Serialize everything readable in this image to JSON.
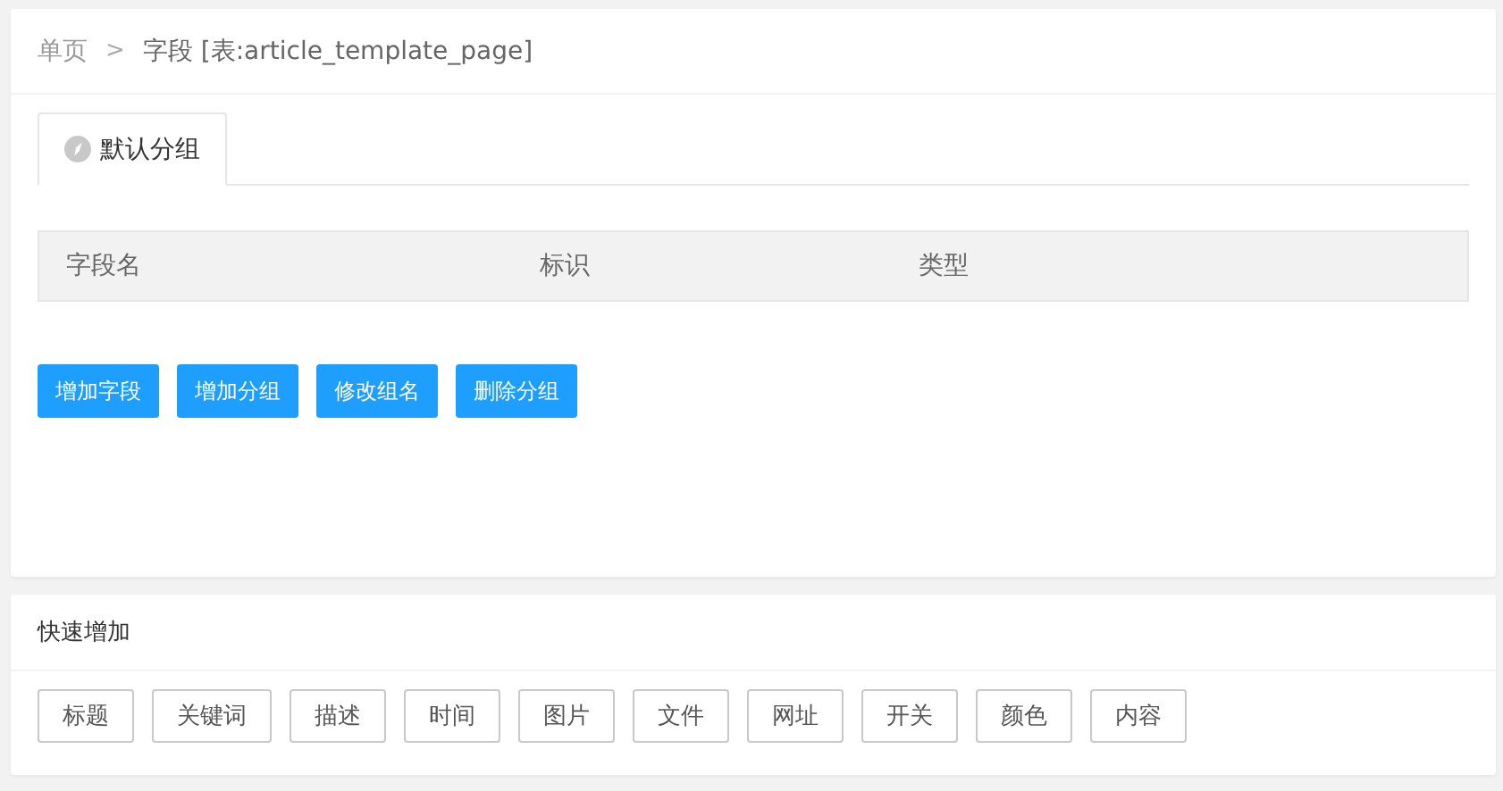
{
  "breadcrumb": [
    {
      "label": "单页",
      "selected": false
    },
    {
      "label": "字段 [表:article_template_page]",
      "selected": true
    }
  ],
  "breadcrumb_separator": ">",
  "tabs": [
    {
      "label": "默认分组",
      "selected": true
    }
  ],
  "table": {
    "columns": [
      "字段名",
      "标识",
      "类型"
    ]
  },
  "buttons": [
    "增加字段",
    "增加分组",
    "修改组名",
    "删除分组"
  ],
  "quick_add": {
    "title": "快速增加",
    "items": [
      "标题",
      "关键词",
      "描述",
      "时间",
      "图片",
      "文件",
      "网址",
      "开关",
      "颜色",
      "内容"
    ]
  }
}
